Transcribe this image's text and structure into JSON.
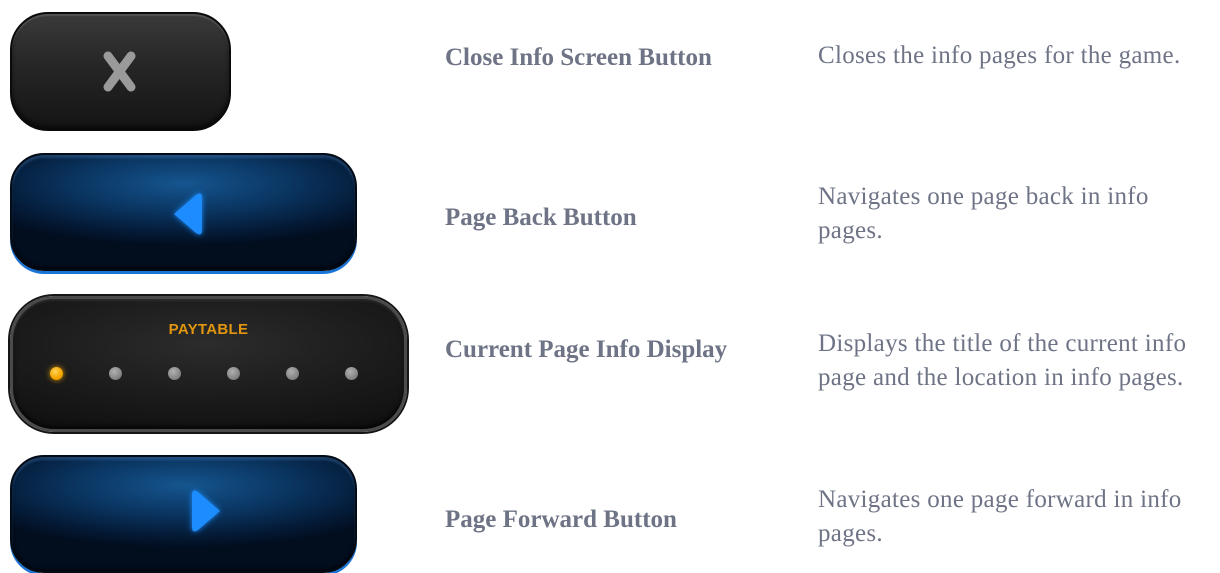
{
  "controls": [
    {
      "id": "close",
      "label": "Close Info Screen Button",
      "description": "Closes the info pages for the game.",
      "icon": "close-icon"
    },
    {
      "id": "back",
      "label": "Page Back Button",
      "description": "Navigates one page back in info pages.",
      "icon": "triangle-left-icon"
    },
    {
      "id": "display",
      "label": "Current Page Info Display",
      "description": "Displays the title of the current info page and the location in info pages.",
      "display_title": "PAYTABLE",
      "total_pages": 6,
      "current_page": 1
    },
    {
      "id": "forward",
      "label": "Page Forward Button",
      "description": "Navigates one page forward in info pages.",
      "icon": "triangle-right-icon"
    }
  ],
  "colors": {
    "text": "#6e7486",
    "accent_blue": "#1a8cff",
    "active_dot": "#f5a700",
    "inactive_dot": "#8a8a8a",
    "display_title": "#e0960e"
  }
}
